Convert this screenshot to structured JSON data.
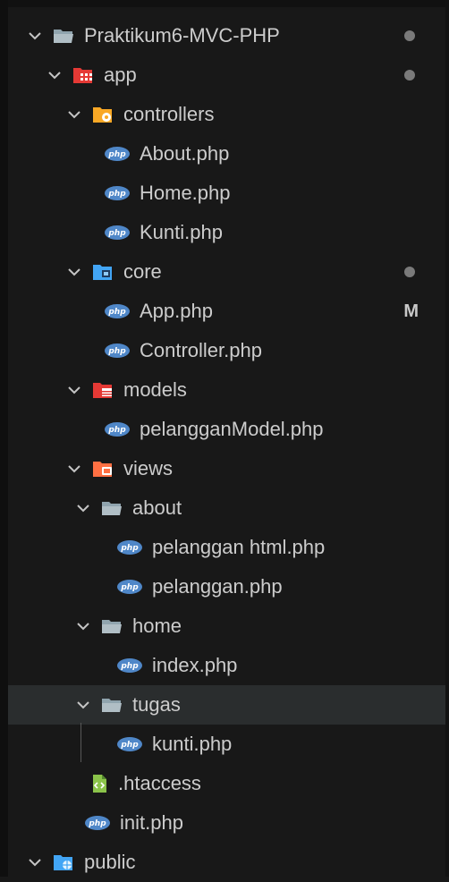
{
  "explorer": {
    "rows": [
      {
        "label": "Praktikum6-MVC-PHP",
        "icon": "folder-open-icon",
        "expanded": true,
        "status": "dot"
      },
      {
        "label": "app",
        "icon": "folder-app-icon",
        "expanded": true,
        "status": "dot"
      },
      {
        "label": "controllers",
        "icon": "folder-controllers-icon",
        "expanded": true
      },
      {
        "label": "About.php",
        "icon": "php-file-icon"
      },
      {
        "label": "Home.php",
        "icon": "php-file-icon"
      },
      {
        "label": "Kunti.php",
        "icon": "php-file-icon"
      },
      {
        "label": "core",
        "icon": "folder-core-icon",
        "expanded": true,
        "status": "dot"
      },
      {
        "label": "App.php",
        "icon": "php-file-icon",
        "status": "M"
      },
      {
        "label": "Controller.php",
        "icon": "php-file-icon"
      },
      {
        "label": "models",
        "icon": "folder-models-icon",
        "expanded": true
      },
      {
        "label": "pelangganModel.php",
        "icon": "php-file-icon"
      },
      {
        "label": "views",
        "icon": "folder-views-icon",
        "expanded": true
      },
      {
        "label": "about",
        "icon": "folder-open-icon",
        "expanded": true
      },
      {
        "label": "pelanggan html.php",
        "icon": "php-file-icon"
      },
      {
        "label": "pelanggan.php",
        "icon": "php-file-icon"
      },
      {
        "label": "home",
        "icon": "folder-open-icon",
        "expanded": true
      },
      {
        "label": "index.php",
        "icon": "php-file-icon"
      },
      {
        "label": "tugas",
        "icon": "folder-open-icon",
        "expanded": true,
        "hovered": true
      },
      {
        "label": "kunti.php",
        "icon": "php-file-icon"
      },
      {
        "label": ".htaccess",
        "icon": "htaccess-file-icon"
      },
      {
        "label": "init.php",
        "icon": "php-file-icon"
      },
      {
        "label": "public",
        "icon": "folder-public-icon",
        "expanded": true
      }
    ]
  },
  "colors": {
    "background": "#181818",
    "hover": "#2a2d2e",
    "text": "#cccccc",
    "php_icon": "#4f87c8",
    "folder_grey": "#90a4ae",
    "folder_red": "#e53935",
    "folder_yellow": "#f9a825",
    "folder_blue": "#42a5f5",
    "folder_orange": "#ff7043",
    "htaccess_green": "#8bc34a"
  }
}
